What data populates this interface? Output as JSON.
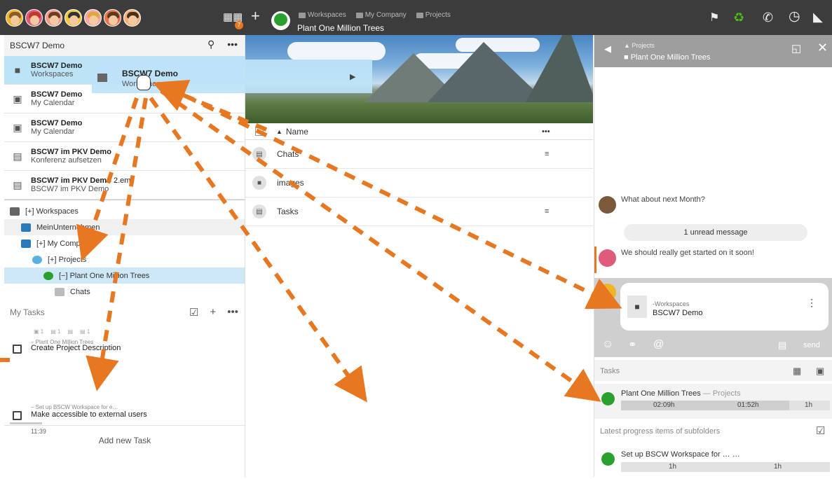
{
  "topbar": {
    "breadcrumb": [
      "Workspaces",
      "My Company",
      "Projects"
    ],
    "workspace_title": "Plant One Million Trees",
    "notification_badge": "7",
    "avatar_count": 7
  },
  "left": {
    "header_title": "BSCW7 Demo",
    "recent": [
      {
        "title": "BSCW7 Demo",
        "sub": "Workspaces",
        "icon": "folder-icon",
        "selected": true
      },
      {
        "title": "BSCW7 Demo",
        "sub": "My Calendar",
        "icon": "calendar-icon"
      },
      {
        "title": "BSCW7 Demo",
        "sub": "My Calendar",
        "icon": "calendar-icon"
      },
      {
        "title_a": "BSCW7 im PKV ",
        "title_b": "Demo",
        "sub": "Konferenz aufsetzen",
        "icon": "chat-icon"
      },
      {
        "title_a": "BSCW7 im PKV ",
        "title_b": "Demo",
        "title_c": " 2.eml",
        "sub": "BSCW7 im PKV Demo",
        "icon": "document-icon"
      }
    ],
    "tree": [
      {
        "label": "[+] Workspaces"
      },
      {
        "label": "MeinUnternehmen"
      },
      {
        "label": "[+] My Company"
      },
      {
        "label": "[+] Projects"
      },
      {
        "label": "[−] Plant One Million Trees"
      },
      {
        "label": "Chats"
      }
    ],
    "tasks": {
      "title": "My Tasks",
      "items": [
        {
          "context": "– Plant One Million Trees",
          "title": "Create Project Description",
          "counts": [
            "1",
            "1",
            "1"
          ]
        },
        {
          "context": "– Set up BSCW Workspace for e…",
          "title": "Make accessible to external users",
          "time": "11:39"
        }
      ],
      "add_label": "Add new Task"
    }
  },
  "drag_ghost": {
    "title": "BSCW7 Demo",
    "sub": "Workspaces"
  },
  "middle": {
    "column_name": "Name",
    "items": [
      {
        "name": "Chats",
        "icon": "chat-icon",
        "has_menu": true
      },
      {
        "name": "images",
        "icon": "folder-icon",
        "has_menu": false
      },
      {
        "name": "Tasks",
        "icon": "tasks-icon",
        "has_menu": true
      }
    ]
  },
  "right": {
    "header_path": "Projects",
    "header_title": "Plant One Million Trees",
    "messages": [
      {
        "text": "What about next Month?"
      },
      {
        "text": "We should really get started on it soon!"
      }
    ],
    "unread_label": "1 unread message",
    "attachment": {
      "path": "-Workspaces",
      "title": "BSCW7 Demo"
    },
    "send_label": "send",
    "tasks_title": "Tasks",
    "task1": {
      "name": "Plant One Million Trees",
      "context": "Projects",
      "t1": "02:09h",
      "t2": "01:52h",
      "t3": "1h"
    },
    "progress_title": "Latest progress items of subfolders",
    "task2": {
      "name": "Set up BSCW Workspace for …",
      "t1": "1h",
      "t2": "1h"
    }
  },
  "colors": {
    "arrow": "#e87722",
    "tree_green": "#2ca02c",
    "topbar": "#3c3c3c",
    "selection": "#bde3f7"
  }
}
